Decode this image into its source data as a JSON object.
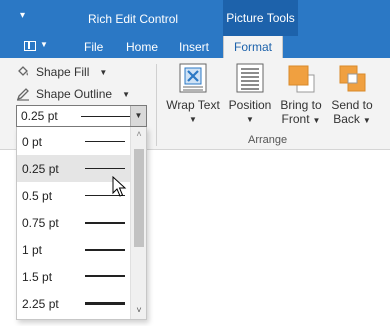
{
  "titlebar": {
    "qat_icon": "quick-access-dropdown-icon",
    "title": "Rich Edit Control",
    "context_header": "Picture Tools"
  },
  "tabs": {
    "file_menu_icon": "document-menu-icon",
    "items": [
      {
        "label": "File"
      },
      {
        "label": "Home"
      },
      {
        "label": "Insert"
      },
      {
        "label": "Format",
        "active": true
      }
    ]
  },
  "ribbon": {
    "shape_fill": {
      "label": "Shape Fill",
      "icon": "paint-bucket-icon"
    },
    "shape_outline": {
      "label": "Shape Outline",
      "icon": "pencil-icon"
    },
    "buttons": [
      {
        "label": "Wrap Text",
        "icon": "wrap-text-icon"
      },
      {
        "label": "Position",
        "icon": "position-icon"
      },
      {
        "label_line1": "Bring to",
        "label_line2": "Front",
        "icon": "bring-to-front-icon"
      },
      {
        "label_line1": "Send to",
        "label_line2": "Back",
        "icon": "send-to-back-icon"
      }
    ],
    "group_label": "Arrange"
  },
  "outline_weight": {
    "selected": "0.25 pt",
    "options": [
      {
        "label": "0 pt",
        "weight": 0.5
      },
      {
        "label": "0.25 pt",
        "weight": 1,
        "hover": true
      },
      {
        "label": "0.5 pt",
        "weight": 1
      },
      {
        "label": "0.75 pt",
        "weight": 1.5
      },
      {
        "label": "1 pt",
        "weight": 1.5
      },
      {
        "label": "1.5 pt",
        "weight": 2
      },
      {
        "label": "2.25 pt",
        "weight": 3
      }
    ]
  },
  "colors": {
    "titlebar": "#2b78c5",
    "context_header": "#1d62ab",
    "ribbon_bg": "#f3f3f3",
    "icon_blue": "#2b78c5",
    "icon_orange": "#f0a040"
  }
}
